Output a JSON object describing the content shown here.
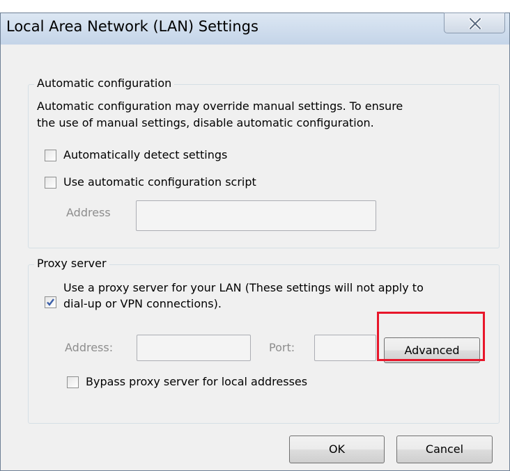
{
  "window": {
    "title": "Local Area Network (LAN) Settings",
    "close_icon": "close-icon"
  },
  "automatic_configuration": {
    "legend": "Automatic configuration",
    "description_line1": "Automatic configuration may override manual settings.  To ensure",
    "description_line2": "the use of manual settings, disable automatic configuration.",
    "detect_settings_label": "Automatically detect settings",
    "detect_settings_checked": false,
    "use_script_label": "Use automatic configuration script",
    "use_script_checked": false,
    "address_label": "Address",
    "address_value": ""
  },
  "proxy_server": {
    "legend": "Proxy server",
    "use_proxy_label_line1": "Use a proxy server for your LAN (These settings will not apply to",
    "use_proxy_label_line2": "dial-up or VPN connections).",
    "use_proxy_checked": true,
    "address_label": "Address:",
    "address_value": "",
    "port_label": "Port:",
    "port_value": "",
    "advanced_label": "Advanced",
    "bypass_label": "Bypass proxy server for local addresses",
    "bypass_checked": false
  },
  "footer": {
    "ok_label": "OK",
    "cancel_label": "Cancel"
  },
  "colors": {
    "title_gradient_top": "#dce7f3",
    "highlight": "#e8162a",
    "disabled_text": "#8d8d8d",
    "checkmark": "#3a5ea8"
  }
}
